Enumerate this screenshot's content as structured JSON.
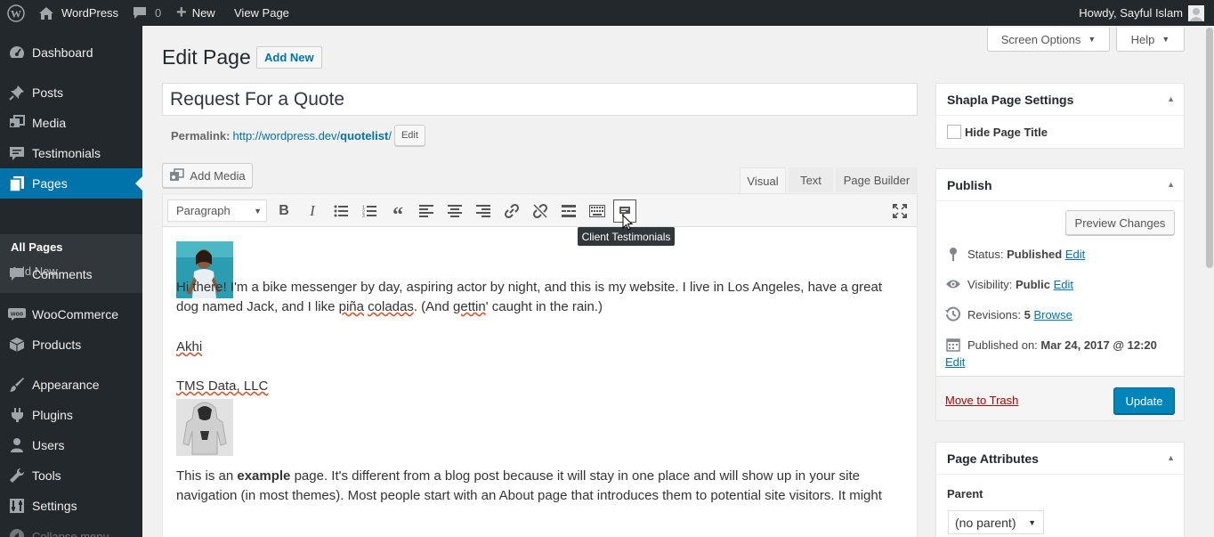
{
  "adminbar": {
    "site_name": "WordPress",
    "comments_count": "0",
    "new_label": "New",
    "view_label": "View Page",
    "greeting": "Howdy, Sayful Islam"
  },
  "sidebar": {
    "items": [
      {
        "label": "Dashboard",
        "icon": "dashboard-icon"
      },
      {
        "label": "Posts",
        "icon": "pin-icon"
      },
      {
        "label": "Media",
        "icon": "media-icon"
      },
      {
        "label": "Testimonials",
        "icon": "testimonial-icon"
      },
      {
        "label": "Pages",
        "icon": "pages-icon"
      },
      {
        "label": "Comments",
        "icon": "comments-icon"
      },
      {
        "label": "WooCommerce",
        "icon": "woo-icon"
      },
      {
        "label": "Products",
        "icon": "products-icon"
      },
      {
        "label": "Appearance",
        "icon": "brush-icon"
      },
      {
        "label": "Plugins",
        "icon": "plugin-icon"
      },
      {
        "label": "Users",
        "icon": "users-icon"
      },
      {
        "label": "Tools",
        "icon": "wrench-icon"
      },
      {
        "label": "Settings",
        "icon": "settings-icon"
      },
      {
        "label": "Collapse menu",
        "icon": "collapse-icon"
      }
    ],
    "submenu": [
      "All Pages",
      "Add New"
    ]
  },
  "screen_options": "Screen Options",
  "help": "Help",
  "page_heading": "Edit Page",
  "add_new": "Add New",
  "title_value": "Request For a Quote",
  "permalink": {
    "label": "Permalink:",
    "base": "http://wordpress.dev/",
    "slug": "quotelist",
    "trail": "/",
    "edit": "Edit"
  },
  "editor": {
    "add_media": "Add Media",
    "tabs": [
      "Visual",
      "Text",
      "Page Builder"
    ],
    "format_select": "Paragraph",
    "tooltip": "Client Testimonials"
  },
  "content": {
    "p1_a": "Hi there! I'm a bike messenger by day, aspiring actor by night, and this is my website. I live in Los Angeles, have a great dog named Jack, and I like ",
    "p1_b": "piña",
    "p1_c": " ",
    "p1_d": "coladas",
    "p1_e": ". (And ",
    "p1_f": "gettin",
    "p1_g": "' caught in the rain.)",
    "name": "Akhi",
    "company": "TMS Data, LLC",
    "p2_a": "This is an ",
    "p2_b": "example",
    "p2_c": " page. It's different from a blog post because it will stay in one place and will show up in your site navigation (in most themes). Most people start with an About page that introduces them to potential site visitors. It might"
  },
  "shapla": {
    "title": "Shapla Page Settings",
    "checkbox_label": "Hide Page Title"
  },
  "publish": {
    "title": "Publish",
    "preview": "Preview Changes",
    "status_label": "Status:",
    "status_value": "Published",
    "visibility_label": "Visibility:",
    "visibility_value": "Public",
    "revisions_label": "Revisions:",
    "revisions_value": "5",
    "browse": "Browse",
    "published_label": "Published on:",
    "published_value": "Mar 24, 2017 @ 12:20",
    "edit": "Edit",
    "trash": "Move to Trash",
    "update": "Update"
  },
  "page_attributes": {
    "title": "Page Attributes",
    "parent_label": "Parent",
    "parent_value": "(no parent)"
  },
  "colors": {
    "adminbar": "#23282d",
    "accent": "#0073aa",
    "submenu": "#32373c",
    "trash": "#a00"
  }
}
